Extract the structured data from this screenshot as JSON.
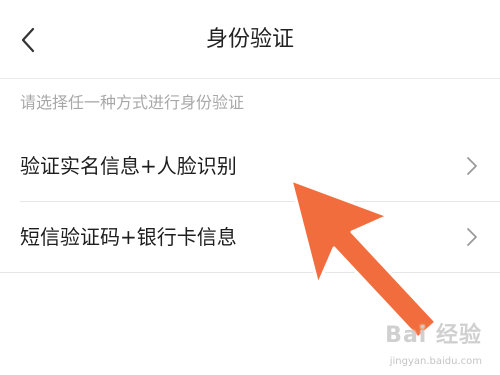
{
  "header": {
    "title": "身份验证",
    "back_icon": "chevron-left-icon"
  },
  "hint": "请选择任一种方式进行身份验证",
  "options": [
    {
      "label": "验证实名信息+人脸识别",
      "icon": "chevron-right-icon"
    },
    {
      "label": "短信验证码+银行卡信息",
      "icon": "chevron-right-icon"
    }
  ],
  "annotation": {
    "arrow_color": "#f26d3d"
  },
  "watermark": {
    "logo": "Bai 经验",
    "url": "jingyan.baidu.com"
  }
}
